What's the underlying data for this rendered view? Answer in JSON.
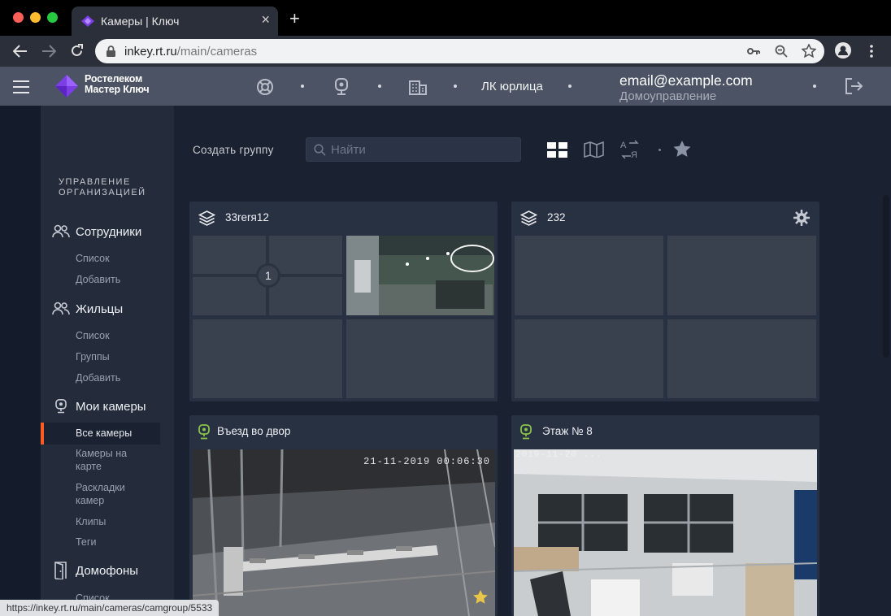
{
  "browser": {
    "tab_title": "Камеры | Ключ",
    "tab_close": "×",
    "new_tab": "+",
    "url_host": "inkey.rt.ru",
    "url_path": "/main/cameras",
    "status_url": "https://inkey.rt.ru/main/cameras/camgroup/5533"
  },
  "header": {
    "logo_line1": "Ростелеком",
    "logo_line2": "Мастер Ключ",
    "org_label": "ЛК юрлица",
    "email": "email@example.com",
    "role": "Домоуправление"
  },
  "sidebar": {
    "section_title_line1": "УПРАВЛЕНИЕ",
    "section_title_line2": "ОРГАНИЗАЦИЕЙ",
    "employees": {
      "label": "Сотрудники",
      "items": [
        "Список",
        "Добавить"
      ]
    },
    "residents": {
      "label": "Жильцы",
      "items": [
        "Список",
        "Группы",
        "Добавить"
      ]
    },
    "cameras": {
      "label": "Мои камеры",
      "items": [
        "Все камеры",
        "Камеры на карте",
        "Раскладки камер",
        "Клипы",
        "Теги"
      ]
    },
    "intercoms": {
      "label": "Домофоны",
      "items": [
        "Список"
      ]
    }
  },
  "toolbar": {
    "create_group": "Создать группу",
    "search_placeholder": "Найти"
  },
  "groups": [
    {
      "title": "33rerя12",
      "badge": "1"
    },
    {
      "title": "232"
    }
  ],
  "cameras": [
    {
      "title": "Въезд во двор",
      "timestamp": "21-11-2019 00:06:30"
    },
    {
      "title": "Этаж № 8",
      "timestamp": "2019-11-20 ..."
    }
  ],
  "colors": {
    "accent": "#ff5a1f",
    "camera_green": "#8bc34a",
    "star": "#e8c64a"
  }
}
